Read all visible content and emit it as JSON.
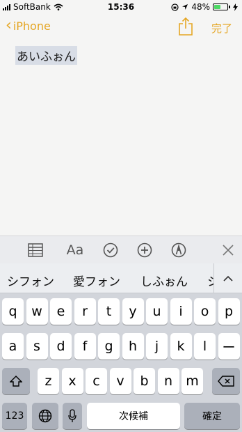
{
  "status": {
    "carrier": "SoftBank",
    "time": "15:36",
    "battery_percent": "48%",
    "battery_level": 0.48,
    "battery_color": "#4cd964"
  },
  "nav": {
    "back_label": "iPhone",
    "done_label": "完了",
    "accent_color": "#e5a623"
  },
  "note": {
    "text": "あいふぉん"
  },
  "toolbar": {
    "icons": [
      "table-icon",
      "format-text-icon",
      "checklist-icon",
      "add-icon",
      "markup-icon",
      "close-icon"
    ],
    "format_label": "Aa"
  },
  "candidates": [
    "シフォン",
    "愛フォン",
    "しふぉん",
    "シ"
  ],
  "keyboard": {
    "row1": [
      "q",
      "w",
      "e",
      "r",
      "t",
      "y",
      "u",
      "i",
      "o",
      "p"
    ],
    "row2": [
      "a",
      "s",
      "d",
      "f",
      "g",
      "h",
      "j",
      "k",
      "l",
      "ー"
    ],
    "row3": [
      "z",
      "x",
      "c",
      "v",
      "b",
      "n",
      "m"
    ],
    "numbers_label": "123",
    "space_label": "次候補",
    "confirm_label": "確定"
  }
}
